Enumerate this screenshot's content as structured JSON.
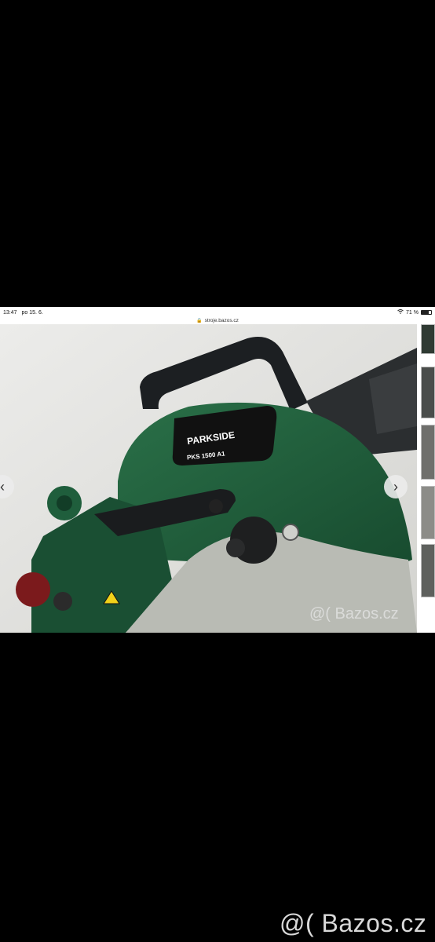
{
  "statusbar": {
    "time": "13:47",
    "date": "po 15. 6.",
    "battery_text": "71 %",
    "battery_level": 0.71
  },
  "browser": {
    "url": "stroje.bazos.cz"
  },
  "photo": {
    "brand": "PARKSIDE",
    "model": "PKS 1500 A1",
    "watermark": "@( Bazos.cz"
  },
  "footer": {
    "watermark": "@( Bazos.cz"
  },
  "colors": {
    "housing_green": "#1f5e3c",
    "handle_black": "#1c1f22",
    "guard_grey": "#b9bbb4"
  },
  "icons": {
    "prev": "chevron-left-icon",
    "next": "chevron-right-icon",
    "lock": "lock-icon",
    "wifi": "wifi-icon",
    "battery": "battery-icon"
  }
}
